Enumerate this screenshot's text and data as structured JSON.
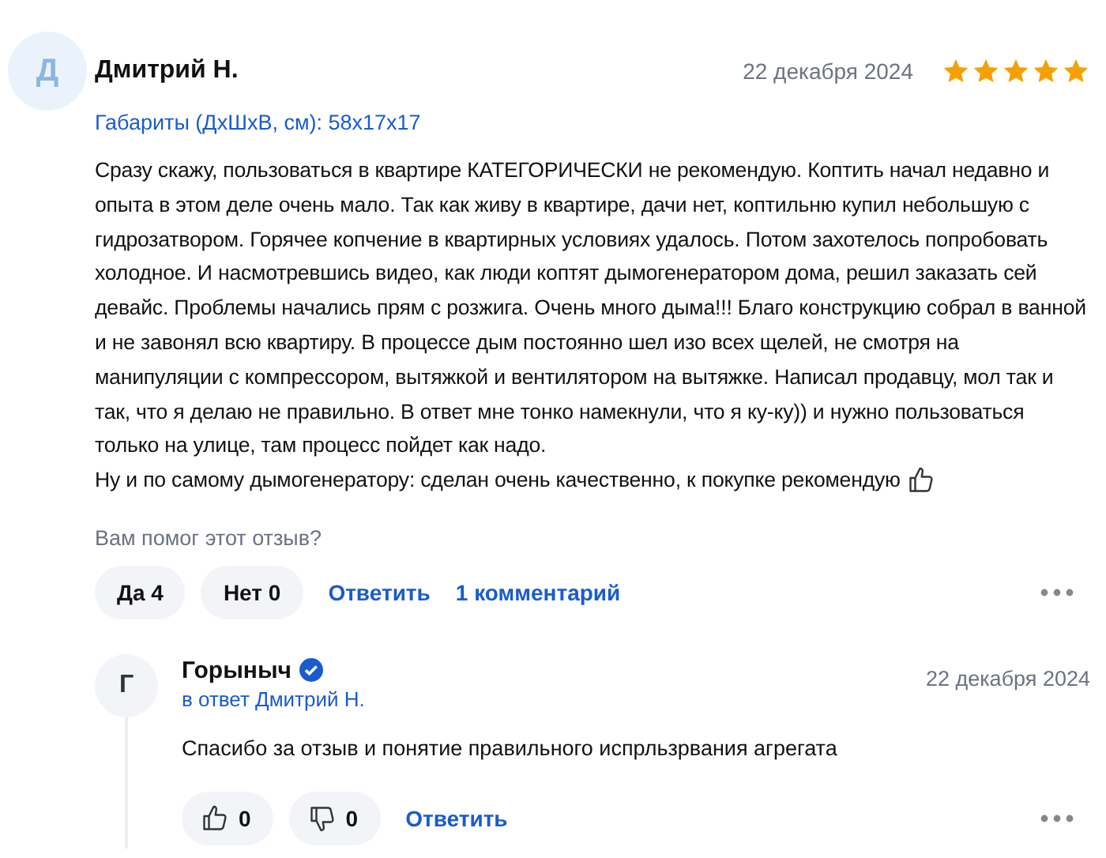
{
  "review": {
    "avatar_letter": "Д",
    "author": "Дмитрий Н.",
    "date": "22 декабря 2024",
    "stars": 5,
    "spec": "Габариты (ДхШхВ, см): 58x17x17",
    "body": [
      "Сразу скажу, пользоваться в квартире КАТЕГОРИЧЕСКИ не рекомендую. Коптить начал недавно и опыта в этом деле очень мало. Так как живу в квартире, дачи нет, коптильню купил небольшую с гидрозатвором. Горячее копчение в квартирных условиях удалось. Потом захотелось попробовать холодное. И насмотревшись видео, как люди коптят дымогенератором дома, решил заказать сей девайс. Проблемы начались прям с розжига. Очень много дыма!!! Благо конструкцию собрал в ванной и не завонял всю квартиру. В процессе дым постоянно шел изо всех щелей, не смотря на манипуляции с компрессором, вытяжкой и вентилятором на вытяжке. Написал продавцу, мол так и так, что я делаю не правильно. В ответ мне тонко намекнули, что я ку-ку)) и нужно пользоваться только на улице, там процесс пойдет как надо.",
      "Ну и по самому дымогенератору: сделан очень качественно, к покупке рекомендую"
    ],
    "helpful_question": "Вам помог этот отзыв?",
    "votes": [
      {
        "label": "Да 4"
      },
      {
        "label": "Нет 0"
      }
    ],
    "links": [
      "Ответить",
      "1 комментарий"
    ]
  },
  "reply": {
    "avatar_letter": "Г",
    "author": "Горыныч",
    "verified": true,
    "in_reply_to": "в ответ Дмитрий Н.",
    "date": "22 декабря 2024",
    "text": "Спасибо за отзыв и понятие правильного испрльзрвания агрегата",
    "votes": [
      {
        "kind": "like",
        "count": "0"
      },
      {
        "kind": "dislike",
        "count": "0"
      }
    ],
    "link": "Ответить"
  }
}
